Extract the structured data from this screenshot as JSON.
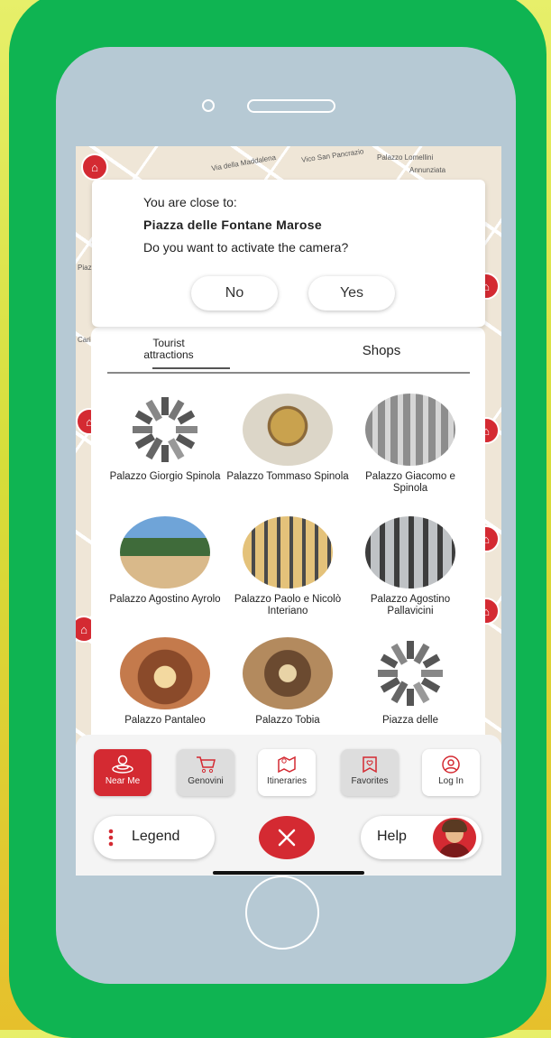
{
  "dialog": {
    "line1": "You are close to:",
    "place": "Piazza delle Fontane Marose",
    "question": "Do you want to activate the camera?",
    "no_label": "No",
    "yes_label": "Yes"
  },
  "tabs": {
    "tourist_label": "Tourist attractions",
    "shops_label": "Shops"
  },
  "cards": [
    {
      "label": "Palazzo Giorgio Spinola",
      "thumb": "placeholder"
    },
    {
      "label": "Palazzo Tommaso Spinola",
      "thumb": "photo"
    },
    {
      "label": "Palazzo Giacomo e Spinola",
      "thumb": "photo"
    },
    {
      "label": "Palazzo Agostino Ayrolo",
      "thumb": "photo"
    },
    {
      "label": "Palazzo Paolo e Nicolò Interiano",
      "thumb": "photo"
    },
    {
      "label": "Palazzo Agostino Pallavicini",
      "thumb": "photo"
    },
    {
      "label": "Palazzo Pantaleo",
      "thumb": "photo"
    },
    {
      "label": "Palazzo Tobia",
      "thumb": "photo"
    },
    {
      "label": "Piazza delle",
      "thumb": "placeholder"
    }
  ],
  "toolbar": {
    "near_me": "Near Me",
    "genovini": "Genovini",
    "itineraries": "Itineraries",
    "favorites": "Favorites",
    "log_in": "Log In",
    "legend": "Legend",
    "help": "Help"
  },
  "map_labels": [
    "Via della Maddalena",
    "Vico San Pancrazio",
    "Palazzo Lomellini",
    "Annunziata",
    "Piazza",
    "Carica"
  ],
  "colors": {
    "phone_frame": "#0fb452",
    "phone_body": "#b6c9d4",
    "accent_red": "#d42a32",
    "background_top": "#e7ef6a",
    "background_bottom": "#e6c02c"
  },
  "icons": [
    "near-me-icon",
    "cart-icon",
    "map-icon",
    "heart-flag-icon",
    "user-icon",
    "more-vertical-icon",
    "close-icon"
  ]
}
